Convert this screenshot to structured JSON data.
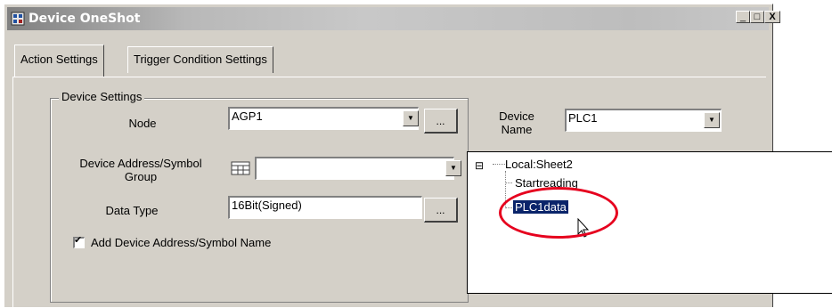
{
  "window": {
    "title": "Device OneShot",
    "minimize_glyph": "_",
    "maximize_glyph": "□",
    "close_glyph": "X"
  },
  "tabs": [
    {
      "label": "Action Settings",
      "active": true
    },
    {
      "label": "Trigger Condition Settings",
      "active": false
    }
  ],
  "device_settings": {
    "group_label": "Device Settings",
    "node_label": "Node",
    "node_value": "AGP1",
    "device_name_label_line1": "Device",
    "device_name_label_line2": "Name",
    "device_name_value": "PLC1",
    "address_label_line1": "Device Address/Symbol",
    "address_label_line2": "Group",
    "address_value": "",
    "data_type_label": "Data Type",
    "data_type_value": "16Bit(Signed)",
    "browse_label": "...",
    "add_name_checkbox_label": "Add Device Address/Symbol Name",
    "add_name_checked": true,
    "check_glyph": "✔",
    "dropdown_glyph": "▼"
  },
  "symbol_tree": {
    "expand_glyph": "⊟",
    "root_label": "Local:Sheet2",
    "children": [
      "Startreading",
      "PLC1data"
    ],
    "selected": "PLC1data"
  },
  "colors": {
    "highlight_ring": "#e6001e",
    "selection": "#0a246a",
    "dialog_face": "#d4d0c8"
  }
}
